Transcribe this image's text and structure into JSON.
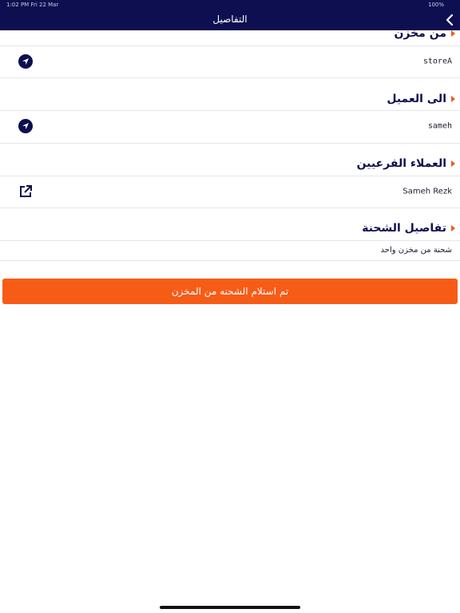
{
  "status_bar": {
    "time": "1:02 PM  Fri 22 Mar",
    "battery": "100%"
  },
  "header": {
    "title": "التفاصيل"
  },
  "sections": {
    "from_store": {
      "title": "من مخزن",
      "value": "storeA"
    },
    "to_customer": {
      "title": "الى العميل",
      "value": "sameh"
    },
    "sub_customers": {
      "title": "العملاء الفرعيين",
      "value": "Sameh Rezk"
    },
    "shipment_details": {
      "title": "تفاصيل الشحنة",
      "value": "شحنة من مخزن واحد"
    }
  },
  "action_button": {
    "label": "تم استلام الشحنه من المخزن"
  },
  "colors": {
    "header": "#0e0f50",
    "accent": "#f75c17",
    "marker": "#f05a14"
  },
  "icons": {
    "navigate": "navigation-arrow-icon",
    "external": "open-external-icon",
    "back": "chevron-left-icon"
  }
}
